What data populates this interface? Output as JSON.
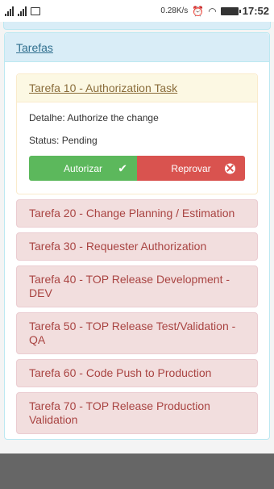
{
  "status_bar": {
    "speed": "0.28K/s",
    "time": "17:52",
    "icons": [
      "signal-icon",
      "signal-icon",
      "image-icon",
      "alarm-icon",
      "wifi-icon",
      "battery-icon"
    ]
  },
  "panel": {
    "title": "Tarefas"
  },
  "active_task": {
    "title": "Tarefa 10 - Authorization Task",
    "detail": "Detalhe: Authorize the change",
    "status": "Status: Pending",
    "approve_label": "Autorizar",
    "reject_label": "Reprovar"
  },
  "tasks": [
    "Tarefa 20 - Change Planning / Estimation",
    "Tarefa 30 - Requester Authorization",
    "Tarefa 40 - TOP Release Development - DEV",
    "Tarefa 50 - TOP Release Test/Validation - QA",
    "Tarefa 60 - Code Push to Production",
    "Tarefa 70 - TOP Release Production Validation"
  ],
  "colors": {
    "info_bg": "#d9edf7",
    "warning_bg": "#fcf8e3",
    "danger_bg": "#f2dede",
    "success": "#5cb85c",
    "danger": "#d9534f"
  }
}
